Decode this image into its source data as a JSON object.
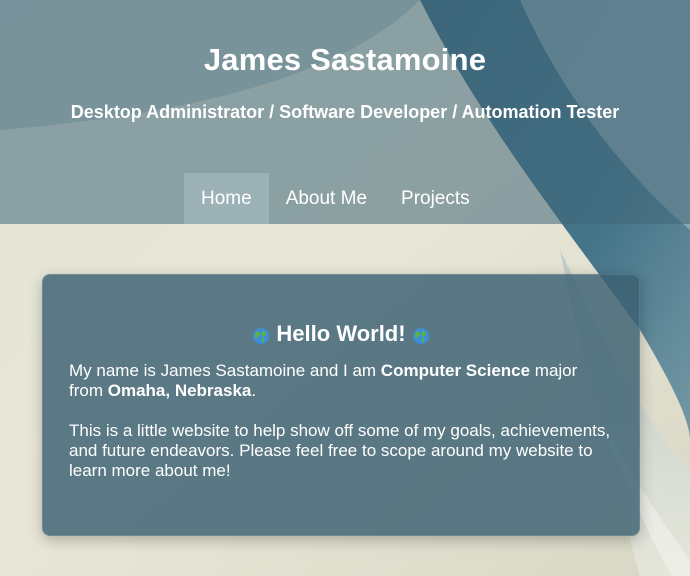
{
  "header": {
    "name": "James Sastamoine",
    "tagline": "Desktop Administrator / Software Developer / Automation Tester"
  },
  "nav": {
    "items": [
      {
        "label": "Home",
        "active": true
      },
      {
        "label": "About Me",
        "active": false
      },
      {
        "label": "Projects",
        "active": false
      }
    ]
  },
  "intro": {
    "title": "Hello World!",
    "title_icon": "globe-icon",
    "p1_a": "My name is James Sastamoine and I am ",
    "p1_b": "Computer Science",
    "p1_c": " major from ",
    "p1_d": "Omaha, Nebraska",
    "p1_e": ".",
    "p2": "This is a little website to help show off some of my goals, achievements, and future endeavors. Please feel free to scope around my website to learn more about me!"
  },
  "colors": {
    "header_overlay": "#406678",
    "card_bg": "#3a6072",
    "nav_active": "#aabec3",
    "text": "#ffffff"
  }
}
